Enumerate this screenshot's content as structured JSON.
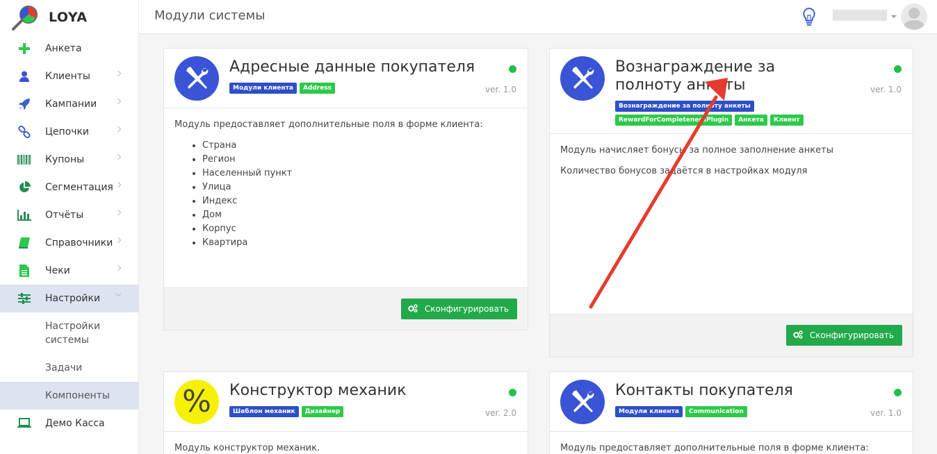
{
  "app": {
    "name": "LOYA"
  },
  "header": {
    "title": "Модули системы"
  },
  "sidebar": {
    "items": [
      {
        "label": "Анкета",
        "icon": "plus-icon",
        "color": "#2ec84a",
        "chevron": false
      },
      {
        "label": "Клиенты",
        "icon": "user-icon",
        "color": "#3954d4",
        "chevron": true
      },
      {
        "label": "Кампании",
        "icon": "rocket-icon",
        "color": "#3a62c9",
        "chevron": true
      },
      {
        "label": "Цепочки",
        "icon": "link-icon",
        "color": "#3a62c9",
        "chevron": true
      },
      {
        "label": "Купоны",
        "icon": "barcode-icon",
        "color": "#2e8b57",
        "chevron": true
      },
      {
        "label": "Сегментация",
        "icon": "pie-icon",
        "color": "#1f8f4e",
        "chevron": true
      },
      {
        "label": "Отчёты",
        "icon": "bar-chart-icon",
        "color": "#2e8b57",
        "chevron": true
      },
      {
        "label": "Справочники",
        "icon": "book-icon",
        "color": "#2ec84a",
        "chevron": true
      },
      {
        "label": "Чеки",
        "icon": "file-icon",
        "color": "#2ec84a",
        "chevron": true
      },
      {
        "label": "Настройки",
        "icon": "sliders-icon",
        "color": "#1f8f4e",
        "chevron": true,
        "active": true
      }
    ],
    "sub_items": [
      {
        "label": "Настройки системы"
      },
      {
        "label": "Задачи"
      },
      {
        "label": "Компоненты",
        "active": true
      }
    ],
    "last_item": {
      "label": "Демо Касса",
      "icon": "laptop-icon",
      "color": "#1f8f4e"
    }
  },
  "cards": [
    {
      "title": "Адресные данные покупателя",
      "tags": [
        {
          "text": "Модули клиента",
          "color": "blue"
        },
        {
          "text": "Address",
          "color": "green"
        }
      ],
      "version": "ver. 1.0",
      "intro": "Модуль предоставляет дополнительные поля в форме клиента:",
      "list": [
        "Страна",
        "Регион",
        "Населенный пункт",
        "Улица",
        "Индекс",
        "Дом",
        "Корпус",
        "Квартира"
      ],
      "button": "Сконфигурировать"
    },
    {
      "title": "Вознаграждение за полноту анкеты",
      "tags": [
        {
          "text": "Вознаграждение за полноту анкеты",
          "color": "blue"
        },
        {
          "text": "RewardForCompletenessPlugin",
          "color": "green"
        },
        {
          "text": "Анкета",
          "color": "green"
        },
        {
          "text": "Клиент",
          "color": "green"
        }
      ],
      "version": "ver. 1.0",
      "paragraphs": [
        "Модуль начисляет бонусы за полное заполнение анкеты",
        "Количество бонусов задаётся в настройках модуля"
      ],
      "button": "Сконфигурировать"
    },
    {
      "title": "Конструктор механик",
      "icon_text": "%",
      "tags": [
        {
          "text": "Шаблон механик",
          "color": "blue"
        },
        {
          "text": "Дизайнер",
          "color": "green"
        }
      ],
      "version": "ver. 2.0",
      "intro": "Модуль конструктор механик."
    },
    {
      "title": "Контакты покупателя",
      "tags": [
        {
          "text": "Модули клиента",
          "color": "blue"
        },
        {
          "text": "Communication",
          "color": "green"
        }
      ],
      "version": "ver. 1.0",
      "intro": "Модуль предоставляет дополнительные поля в форме клиента:"
    }
  ],
  "annotation": {
    "color": "#e53b2f"
  }
}
